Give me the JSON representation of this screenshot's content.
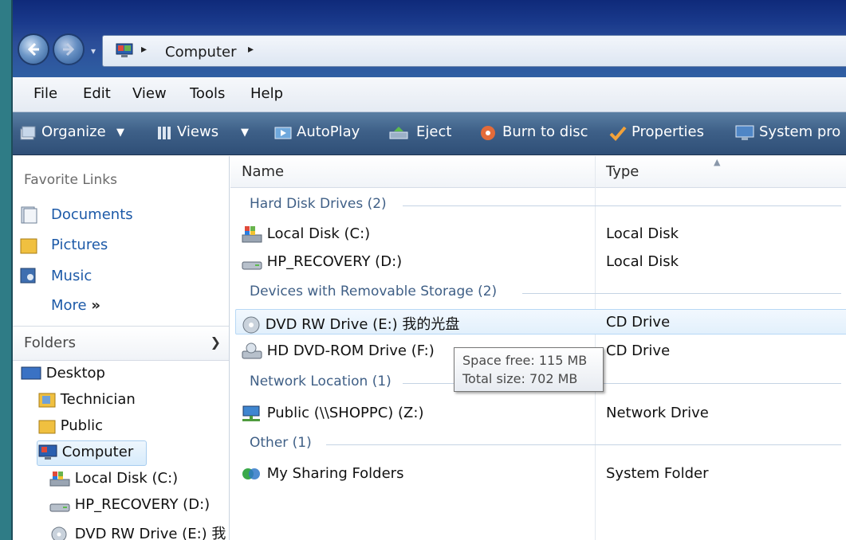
{
  "address_bar": {
    "path": "Computer"
  },
  "menu": [
    "File",
    "Edit",
    "View",
    "Tools",
    "Help"
  ],
  "toolbar": {
    "organize": "Organize",
    "views": "Views",
    "autoplay": "AutoPlay",
    "eject": "Eject",
    "burn": "Burn to disc",
    "properties": "Properties",
    "system_properties": "System pro"
  },
  "navpane": {
    "favorites_title": "Favorite Links",
    "favorites": [
      "Documents",
      "Pictures",
      "Music"
    ],
    "more": "More",
    "folders_title": "Folders",
    "tree": [
      "Desktop",
      "Technician",
      "Public",
      "Computer",
      "Local Disk (C:)",
      "HP_RECOVERY (D:)",
      "DVD RW Drive (E:) 我"
    ]
  },
  "columns": {
    "name": "Name",
    "type": "Type"
  },
  "groups": {
    "hdd": "Hard Disk Drives (2)",
    "removable": "Devices with Removable Storage (2)",
    "network": "Network Location (1)",
    "other": "Other (1)"
  },
  "items": [
    {
      "name": "Local Disk (C:)",
      "type": "Local Disk",
      "icon": "hard-drive-windows-icon"
    },
    {
      "name": "HP_RECOVERY (D:)",
      "type": "Local Disk",
      "icon": "hard-drive-icon"
    },
    {
      "name": "DVD RW Drive (E:) 我的光盘",
      "type": "CD Drive",
      "icon": "optical-disc-icon"
    },
    {
      "name": "HD DVD-ROM Drive (F:)",
      "type": "CD Drive",
      "icon": "dvd-drive-icon"
    },
    {
      "name": "Public (\\\\SHOPPC) (Z:)",
      "type": "Network Drive",
      "icon": "network-drive-icon"
    },
    {
      "name": "My Sharing Folders",
      "type": "System Folder",
      "icon": "sharing-folders-icon"
    }
  ],
  "tooltip": {
    "free": "Space free: 115 MB",
    "total": "Total size: 702 MB"
  },
  "colors": {
    "toolbar": "#3e6088",
    "titlebar": "#1a3a8c",
    "link": "#1d5aa8",
    "group_header": "#3f5f86",
    "background": "#2f7c86"
  }
}
